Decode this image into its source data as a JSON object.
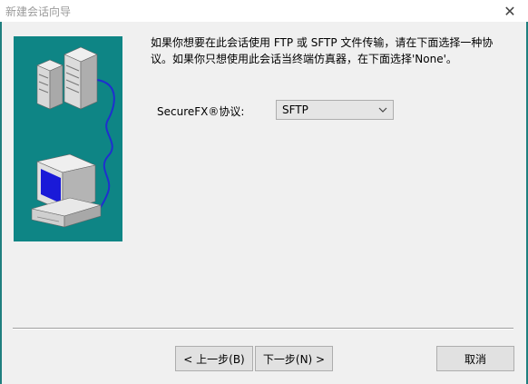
{
  "window": {
    "title": "新建会话向导",
    "close_symbol": "✕"
  },
  "content": {
    "description": "如果你想要在此会话使用 FTP 或 SFTP 文件传输，请在下面选择一种协议。如果你只想使用此会话当终端仿真器，在下面选择'None'。",
    "protocol_label": "SecureFX®协议:",
    "protocol_value": "SFTP",
    "dropdown_icon": "chevron-down-icon"
  },
  "buttons": {
    "back": "< 上一步(B)",
    "next": "下一步(N) >",
    "cancel": "取消"
  },
  "colors": {
    "illustration_bg": "#0e8585",
    "cable": "#1f2fd0",
    "screen": "#1a1ad8"
  }
}
